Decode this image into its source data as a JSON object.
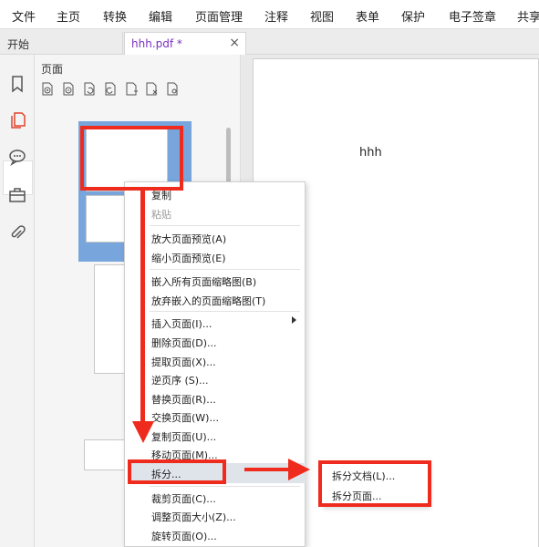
{
  "menubar": {
    "items": [
      "文件",
      "主页",
      "转换",
      "编辑",
      "页面管理",
      "注释",
      "视图",
      "表单",
      "保护",
      "电子签章",
      "共享"
    ]
  },
  "tabs": {
    "home": "开始",
    "file": "hhh.pdf *",
    "close": "×"
  },
  "sidebar": {
    "icons": [
      "bookmark-icon",
      "pages-icon",
      "comment-icon",
      "toolbox-icon",
      "attachment-icon"
    ]
  },
  "thumbnails": {
    "title": "页面",
    "tools": [
      "zoom-in-page-icon",
      "zoom-out-page-icon",
      "rotate-left-icon",
      "rotate-right-icon",
      "insert-page-icon",
      "delete-page-icon",
      "page-settings-icon"
    ]
  },
  "document": {
    "text": "hhh"
  },
  "context_menu": {
    "items": [
      {
        "label": "复制",
        "disabled": false
      },
      {
        "label": "粘贴",
        "disabled": true
      },
      {
        "label": "放大页面预览(A)",
        "disabled": false
      },
      {
        "label": "缩小页面预览(E)",
        "disabled": false
      },
      {
        "label": "嵌入所有页面缩略图(B)",
        "disabled": false
      },
      {
        "label": "放弃嵌入的页面缩略图(T)",
        "disabled": false
      },
      {
        "label": "插入页面(I)...",
        "disabled": false,
        "submenu": true
      },
      {
        "label": "删除页面(D)...",
        "disabled": false
      },
      {
        "label": "提取页面(X)...",
        "disabled": false
      },
      {
        "label": "逆页序 (S)...",
        "disabled": false
      },
      {
        "label": "替换页面(R)...",
        "disabled": false
      },
      {
        "label": "交换页面(W)...",
        "disabled": false
      },
      {
        "label": "复制页面(U)...",
        "disabled": false
      },
      {
        "label": "移动页面(M)...",
        "disabled": false
      },
      {
        "label": "拆分...",
        "disabled": false,
        "highlighted": true
      },
      {
        "label": "裁剪页面(C)...",
        "disabled": false
      },
      {
        "label": "调整页面大小(Z)...",
        "disabled": false
      },
      {
        "label": "旋转页面(O)...",
        "disabled": false
      }
    ]
  },
  "split_submenu": {
    "items": [
      "拆分文档(L)...",
      "拆分页面..."
    ]
  },
  "colors": {
    "accent": "#7b2fbf",
    "annotation_red": "#ef2b1d",
    "selection_blue": "#78a6dc"
  }
}
